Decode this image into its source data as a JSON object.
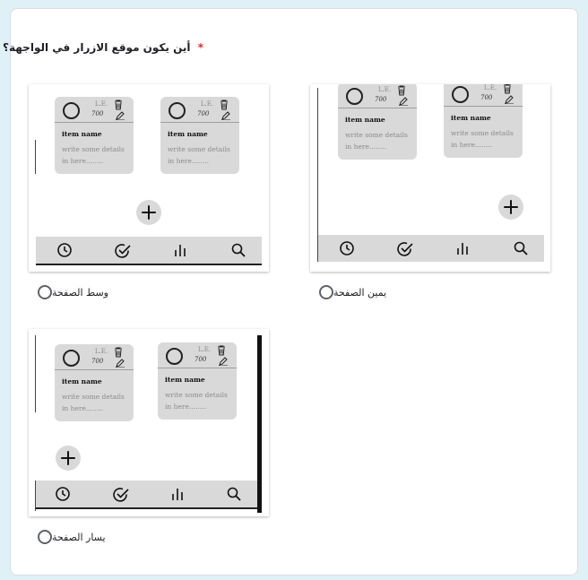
{
  "question": {
    "text": "أين يكون موقع الازرار في الواجهة؟",
    "required_mark": "*"
  },
  "item_card": {
    "currency": "L.E.",
    "price": "700",
    "name": "item name",
    "details": "write some details in here........"
  },
  "options": [
    {
      "label": "وسط الصفحة",
      "fab_position": "center"
    },
    {
      "label": "يمين الصفحة",
      "fab_position": "right"
    },
    {
      "label": "يسار الصفحة",
      "fab_position": "left"
    }
  ],
  "icons": {
    "item": [
      "circle-icon",
      "trash-icon",
      "pencil-icon"
    ],
    "bottom_nav": [
      "clock-icon",
      "check-circle-icon",
      "bar-chart-icon",
      "search-icon"
    ],
    "fab": "plus-icon"
  },
  "colors": {
    "required": "#d93025",
    "card_bg": "#d9d9d9",
    "page_bg": "#dff1f7"
  }
}
